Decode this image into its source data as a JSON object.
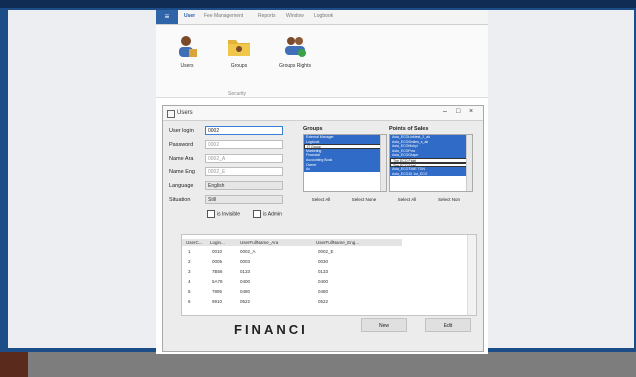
{
  "app": {
    "menu_glyph": "≡",
    "ribbon_tabs": [
      "User",
      "Fee Management",
      "Reports",
      "Window",
      "Logbook"
    ],
    "ribbon_buttons": [
      {
        "label": "Users",
        "icon": "users-icon"
      },
      {
        "label": "Groups",
        "icon": "folder-icon"
      },
      {
        "label": "Groups Rights",
        "icon": "group-rights-icon"
      }
    ],
    "ribbon_group_label": "Security"
  },
  "dialog": {
    "title": "Users",
    "window_buttons": [
      "–",
      "□",
      "×"
    ],
    "fields": [
      {
        "label": "User login",
        "value": "0002"
      },
      {
        "label": "Password",
        "value": "0002"
      },
      {
        "label": "Name Ara",
        "value": "0002_A"
      },
      {
        "label": "Name Eng",
        "value": "0002_E"
      },
      {
        "label": "Language",
        "value": "English"
      },
      {
        "label": "Situation",
        "value": "Still"
      }
    ],
    "checkboxes": [
      "is Invisible",
      "is Admin"
    ],
    "groups_header": "Groups",
    "groups_items": [
      "External Manager",
      "Logbook",
      "IT Group",
      "Marketing",
      "Financial",
      "Accounting Book",
      "Owner",
      "Ac"
    ],
    "groups_selected_index": 2,
    "pos_header": "Points of Sales",
    "pos_items": [
      "Asia_ECOLinktest_2_ak",
      "Asia_ECOSmiles_s_ak",
      "Asia_ECOMobyl",
      "Asia_ECOPow",
      "Asia_ECOGrape",
      "The ECO Fidel",
      "The ECO Fidel",
      "Asia_ECOTIME TON",
      "Asia_ECO15 1st_ECO"
    ],
    "pos_selected_indices": [
      5,
      6
    ],
    "groups_buttons": [
      "Select All",
      "Select None"
    ],
    "pos_buttons": [
      "Select All",
      "Select Non"
    ],
    "grid": {
      "headers": [
        "UserC...",
        "Login...",
        "UserFullName_Ara",
        "UserFullName_Eng..."
      ],
      "rows": [
        [
          "1",
          "0010",
          "0002_A",
          "0002_E"
        ],
        [
          "2",
          "0005",
          "0003",
          "0030"
        ],
        [
          "3",
          "7B56",
          "0133",
          "0133"
        ],
        [
          "4",
          "5A78",
          "0400",
          "0400"
        ],
        [
          "5",
          "7895",
          "0480",
          "0480"
        ],
        [
          "6",
          "9910",
          "0522",
          "0522"
        ]
      ]
    },
    "new_label": "New",
    "edit_label": "Edit"
  },
  "brand_text": "FINANCI",
  "colors": {
    "background": "#1d4d86",
    "accent": "#2f6bc7",
    "panel": "#eceef2"
  }
}
